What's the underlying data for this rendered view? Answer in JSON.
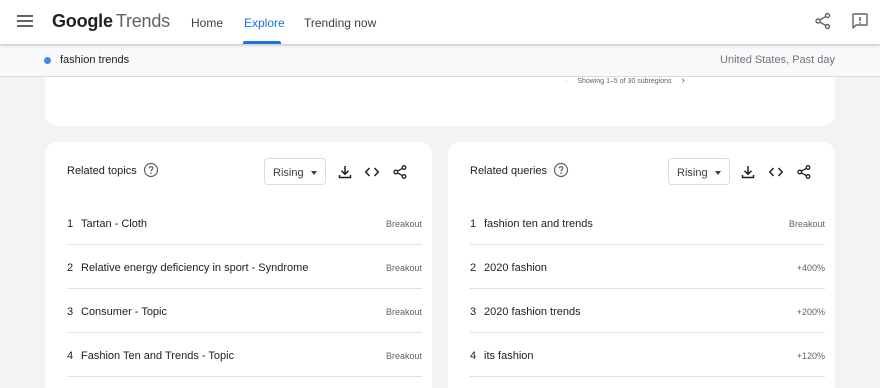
{
  "header": {
    "logo_google": "Google",
    "logo_trends": "Trends",
    "nav": [
      {
        "label": "Home"
      },
      {
        "label": "Explore"
      },
      {
        "label": "Trending now"
      }
    ]
  },
  "term_bar": {
    "term": "fashion trends",
    "meta": "United States, Past day"
  },
  "map_card": {
    "pager_text": "Showing 1–5 of 30 subregions"
  },
  "related_topics": {
    "title": "Related topics",
    "filter": "Rising",
    "rows": [
      {
        "rank": "1",
        "name": "Tartan - Cloth",
        "value": "Breakout"
      },
      {
        "rank": "2",
        "name": "Relative energy deficiency in sport - Syndrome",
        "value": "Breakout"
      },
      {
        "rank": "3",
        "name": "Consumer - Topic",
        "value": "Breakout"
      },
      {
        "rank": "4",
        "name": "Fashion Ten and Trends - Topic",
        "value": "Breakout"
      }
    ]
  },
  "related_queries": {
    "title": "Related queries",
    "filter": "Rising",
    "rows": [
      {
        "rank": "1",
        "name": "fashion ten and trends",
        "value": "Breakout"
      },
      {
        "rank": "2",
        "name": "2020 fashion",
        "value": "+400%"
      },
      {
        "rank": "3",
        "name": "2020 fashion trends",
        "value": "+200%"
      },
      {
        "rank": "4",
        "name": "its fashion",
        "value": "+120%"
      }
    ]
  }
}
